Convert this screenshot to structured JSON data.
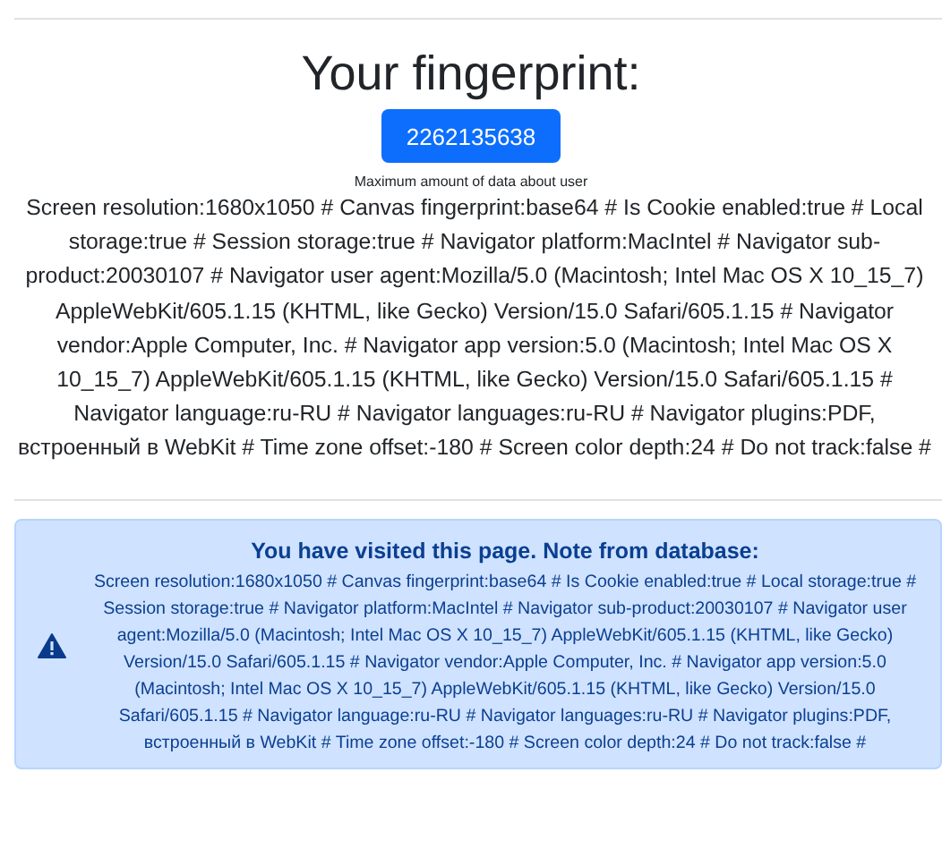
{
  "title": "Your fingerprint:",
  "fingerprint_button": "2262135638",
  "caption": "Maximum amount of data about user",
  "details": "Screen resolution:1680x1050 # Canvas fingerprint:base64 # Is Cookie enabled:true # Local storage:true # Session storage:true # Navigator platform:MacIntel # Navigator sub-product:20030107 # Navigator user agent:Mozilla/5.0 (Macintosh; Intel Mac OS X 10_15_7) AppleWebKit/605.1.15 (KHTML, like Gecko) Version/15.0 Safari/605.1.15 # Navigator vendor:Apple Computer, Inc. # Navigator app version:5.0 (Macintosh; Intel Mac OS X 10_15_7) AppleWebKit/605.1.15 (KHTML, like Gecko) Version/15.0 Safari/605.1.15 # Navigator language:ru-RU # Navigator languages:ru-RU # Navigator plugins:PDF, встроенный в WebKit # Time zone offset:-180 # Screen color depth:24 # Do not track:false #",
  "alert": {
    "kind": "warning",
    "title": "You have visited this page. Note from database:",
    "text": "Screen resolution:1680x1050 # Canvas fingerprint:base64 # Is Cookie enabled:true # Local storage:true # Session storage:true # Navigator platform:MacIntel # Navigator sub-product:20030107 # Navigator user agent:Mozilla/5.0 (Macintosh; Intel Mac OS X 10_15_7) AppleWebKit/605.1.15 (KHTML, like Gecko) Version/15.0 Safari/605.1.15 # Navigator vendor:Apple Computer, Inc. # Navigator app version:5.0 (Macintosh; Intel Mac OS X 10_15_7) AppleWebKit/605.1.15 (KHTML, like Gecko) Version/15.0 Safari/605.1.15 # Navigator language:ru-RU # Navigator languages:ru-RU # Navigator plugins:PDF, встроенный в WebKit # Time zone offset:-180 # Screen color depth:24 # Do not track:false #"
  }
}
